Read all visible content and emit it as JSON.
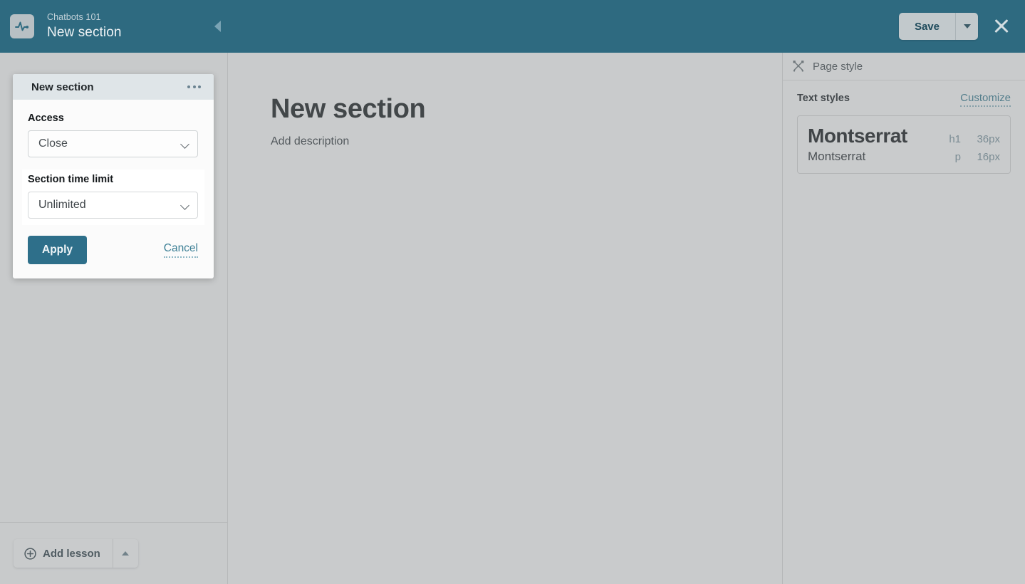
{
  "topbar": {
    "logo_icon": "pulse-icon",
    "breadcrumb": "Chatbots 101",
    "page_title": "New section",
    "collapse_icon": "collapse-left-icon",
    "save_label": "Save",
    "save_caret_icon": "chevron-down-icon",
    "close_icon": "close-icon",
    "background_color": "#2e6a80"
  },
  "left_panel": {
    "add_lesson_label": "Add lesson",
    "add_lesson_icon": "plus-circle-icon",
    "add_lesson_caret_icon": "chevron-up-icon"
  },
  "canvas": {
    "heading": "New section",
    "description": "Add description"
  },
  "popover": {
    "title": "New section",
    "menu_icon": "more-options-icon",
    "access_label": "Access",
    "access_value": "Close",
    "access_caret_icon": "chevron-down-icon",
    "apply_label": "Apply",
    "cancel_label": "Cancel"
  },
  "spotlight": {
    "time_limit_label": "Section time limit",
    "time_limit_value": "Unlimited",
    "time_limit_caret_icon": "chevron-down-icon"
  },
  "right_panel": {
    "header_icon": "design-tools-icon",
    "header_label": "Page style",
    "text_styles_label": "Text styles",
    "customize_label": "Customize",
    "styles": [
      {
        "sample": "Montserrat",
        "tag": "h1",
        "size": "36px"
      },
      {
        "sample": "Montserrat",
        "tag": "p",
        "size": "16px"
      }
    ]
  }
}
